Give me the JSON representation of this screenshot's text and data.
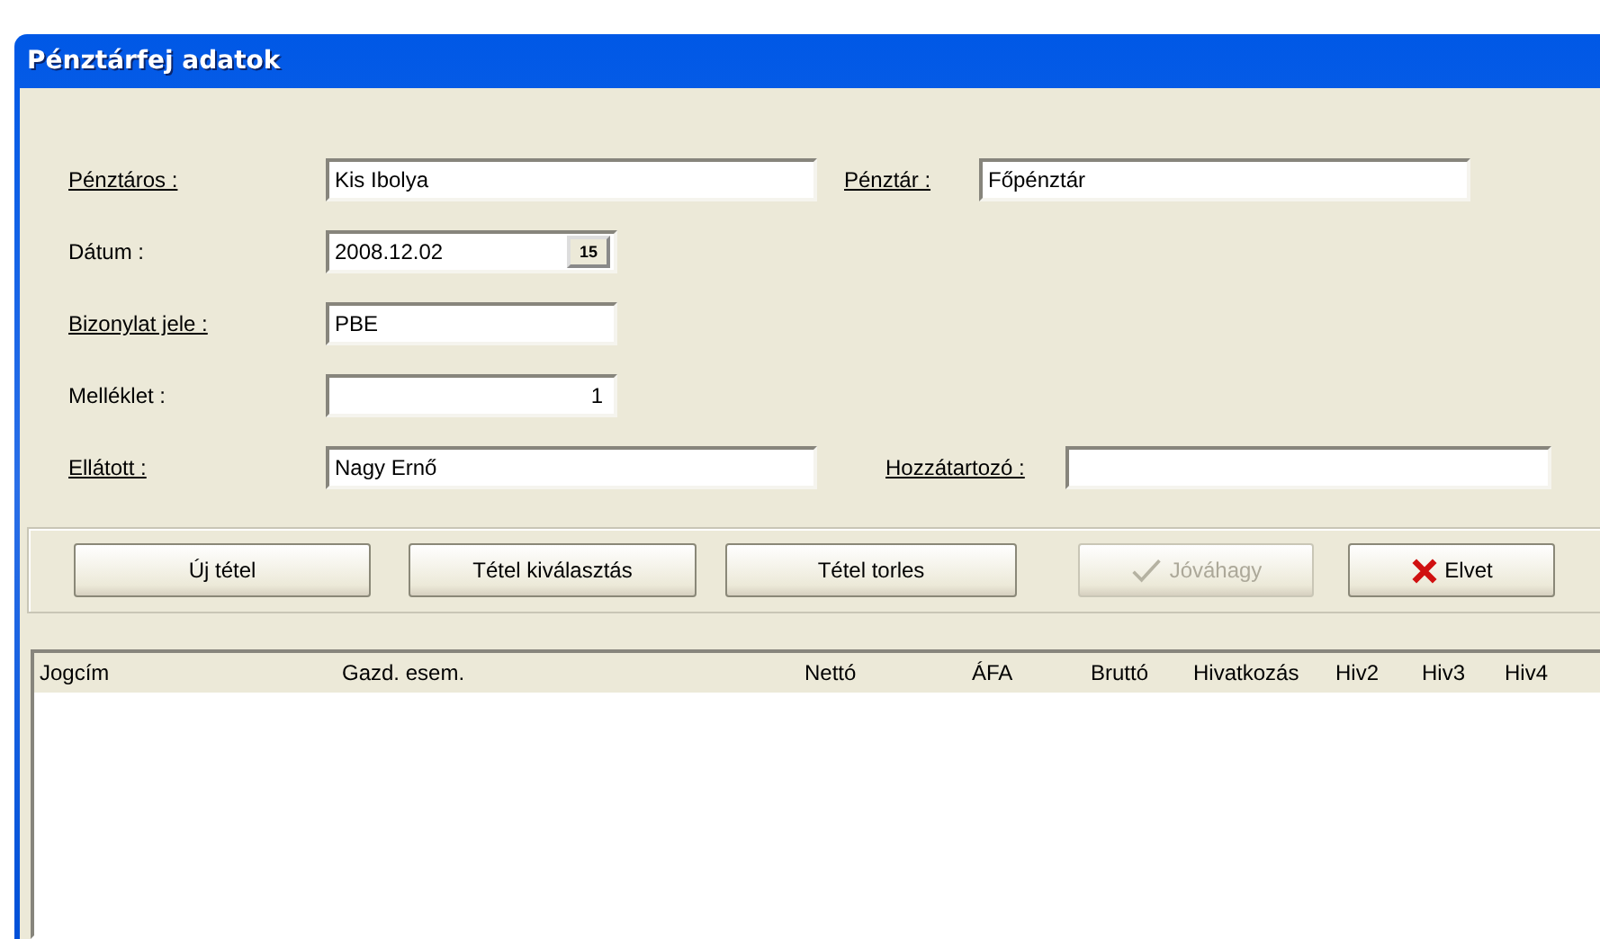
{
  "window": {
    "title": "Pénztárfej adatok"
  },
  "form": [
    {
      "fields": [
        {
          "label": "Pénztáros :",
          "underlined": true,
          "value": "Kis Ibolya"
        },
        {
          "label": "Pénztár :",
          "underlined": true,
          "value": "Főpénztár"
        }
      ]
    },
    {
      "fields": [
        {
          "label": "Dátum :",
          "underlined": false,
          "value": "2008.12.02",
          "calendar": "15"
        }
      ]
    },
    {
      "fields": [
        {
          "label": "Bizonylat jele :",
          "underlined": true,
          "value": "PBE"
        }
      ]
    },
    {
      "fields": [
        {
          "label": "Melléklet :",
          "underlined": false,
          "value": "1"
        }
      ]
    },
    {
      "fields": [
        {
          "label": "Ellátott :",
          "underlined": true,
          "value": "Nagy Ernő"
        },
        {
          "label": "Hozzátartozó :",
          "underlined": true
        }
      ]
    }
  ],
  "buttons": [
    {
      "label": "Új tétel",
      "disabled": false,
      "kind": "plain"
    },
    {
      "label": "Tétel kiválasztás",
      "disabled": false,
      "kind": "plain"
    },
    {
      "label": "Tétel torles",
      "disabled": false,
      "kind": "plain"
    },
    {
      "label": "Jóváhagy",
      "disabled": true,
      "kind": "check"
    },
    {
      "label": "Elvet",
      "disabled": false,
      "kind": "cross"
    }
  ],
  "table": {
    "columns": [
      "Jogcím",
      "Gazd. esem.",
      "Nettó",
      "ÁFA",
      "Bruttó",
      "Hivatkozás",
      "Hiv2",
      "Hiv3",
      "Hiv4"
    ]
  }
}
